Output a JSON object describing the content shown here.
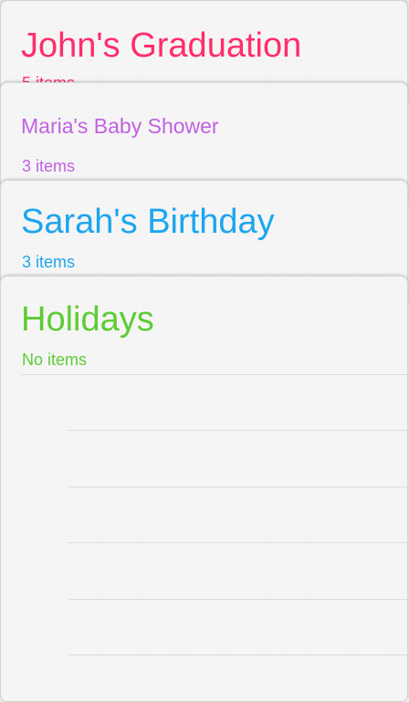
{
  "lists": [
    {
      "title": "John's Graduation",
      "count": "5 items",
      "color": "#ff2d6b"
    },
    {
      "title": "Maria's Baby Shower",
      "count": "3 items",
      "color": "#c062e0"
    },
    {
      "title": "Sarah's Birthday",
      "count": "3 items",
      "color": "#1ca6ee"
    },
    {
      "title": "Holidays",
      "count": "No items",
      "color": "#5dcc35"
    }
  ]
}
